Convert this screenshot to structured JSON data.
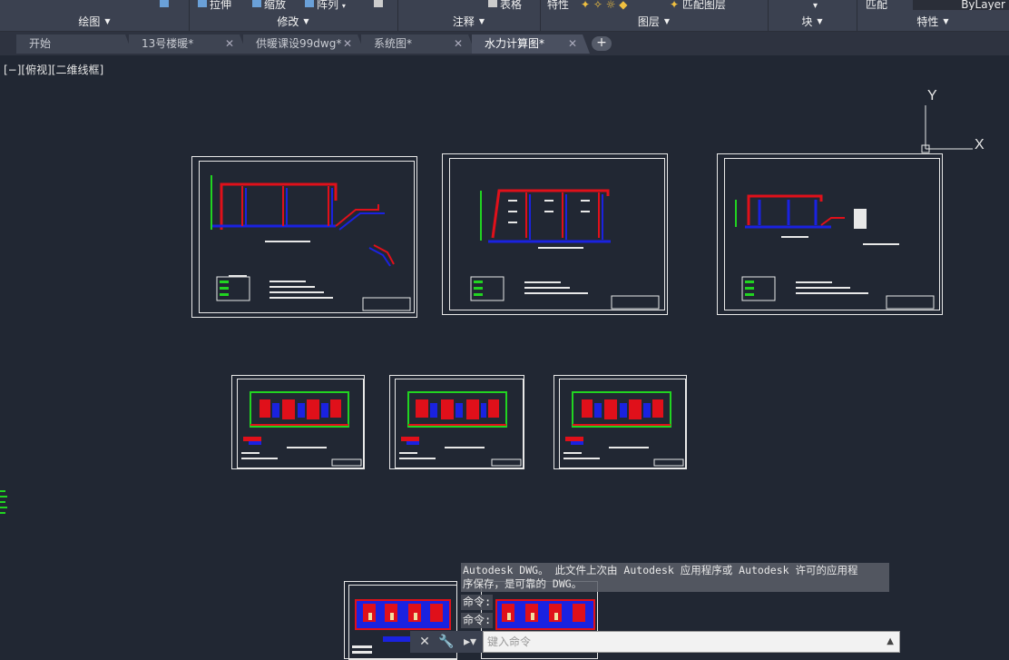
{
  "ribbon": {
    "top_labels": [
      "拉伸",
      "缩放",
      "阵列",
      "表格",
      "特性",
      "匹配图层",
      "匹配",
      "ByLayer"
    ],
    "panels": [
      "绘图",
      "修改",
      "注释",
      "图层",
      "块",
      "特性"
    ]
  },
  "tabs": [
    {
      "label": "开始",
      "active": false,
      "closable": false
    },
    {
      "label": "13号楼暖*",
      "active": false,
      "closable": true
    },
    {
      "label": "供暖课设99dwg*",
      "active": false,
      "closable": true
    },
    {
      "label": "系统图*",
      "active": false,
      "closable": true
    },
    {
      "label": "水力计算图*",
      "active": true,
      "closable": true
    }
  ],
  "tab_add_symbol": "+",
  "viewport_label": "[−][俯视][二维线框]",
  "ucs": {
    "y_label": "Y",
    "x_label": "X"
  },
  "command": {
    "history_line1": "Autodesk DWG。  此文件上次由 Autodesk 应用程序或 Autodesk 许可的应用程",
    "history_line2": "序保存，是可靠的 DWG。",
    "prompt1": "命令:",
    "prompt2": "命令:",
    "input_placeholder": "键入命令"
  },
  "colors": {
    "background": "#212733",
    "ribbon": "#3b4150",
    "supply_pipe": "#e0101a",
    "return_pipe": "#1a22e0",
    "green_lines": "#21d421",
    "sheet_frame": "#e8e8e8"
  }
}
